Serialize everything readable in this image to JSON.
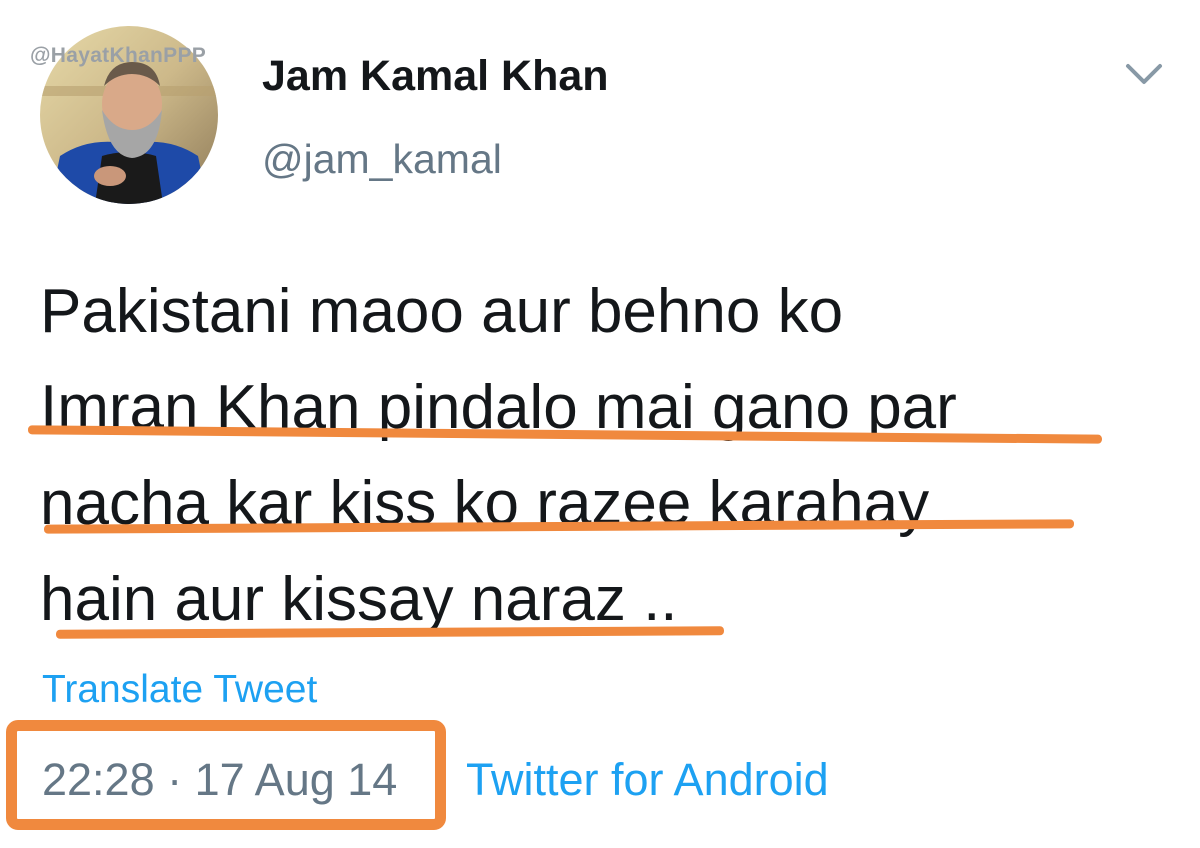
{
  "watermark": "@HayatKhanPPP",
  "author": {
    "display_name": "Jam Kamal Khan",
    "handle": "@jam_kamal",
    "avatar_icon": "profile-photo"
  },
  "menu": {
    "icon": "chevron-down-icon"
  },
  "tweet": {
    "lines": [
      "Pakistani maoo aur behno ko",
      "Imran Khan pindalo mai gano par",
      "nacha kar kiss ko razee karahay",
      "hain aur kissay naraz .."
    ],
    "translate_label": "Translate Tweet",
    "timestamp": "22:28 · 17 Aug 14",
    "source": "Twitter for Android"
  },
  "colors": {
    "accent_link": "#1da1f2",
    "highlight": "#f0893e",
    "secondary_text": "#657786",
    "primary_text": "#14171a"
  }
}
